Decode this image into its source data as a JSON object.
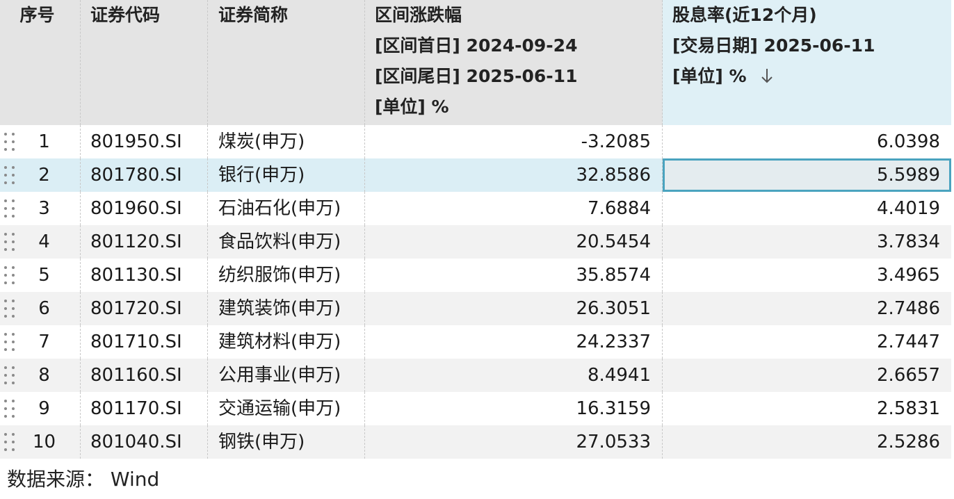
{
  "header": {
    "seq": "序号",
    "code": "证券代码",
    "name": "证券简称",
    "change": {
      "title": "区间涨跌幅",
      "start": "[区间首日] 2024-09-24",
      "end": "[区间尾日] 2025-06-11",
      "unit": "[单位] %"
    },
    "dividend": {
      "title": "股息率(近12个月)",
      "date": "[交易日期] 2025-06-11",
      "unit": "[单位] %",
      "sort_icon": "arrow-down"
    }
  },
  "rows": [
    {
      "seq": "1",
      "code": "801950.SI",
      "name": "煤炭(申万)",
      "change": "-3.2085",
      "dividend": "6.0398"
    },
    {
      "seq": "2",
      "code": "801780.SI",
      "name": "银行(申万)",
      "change": "32.8586",
      "dividend": "5.5989"
    },
    {
      "seq": "3",
      "code": "801960.SI",
      "name": "石油石化(申万)",
      "change": "7.6884",
      "dividend": "4.4019"
    },
    {
      "seq": "4",
      "code": "801120.SI",
      "name": "食品饮料(申万)",
      "change": "20.5454",
      "dividend": "3.7834"
    },
    {
      "seq": "5",
      "code": "801130.SI",
      "name": "纺织服饰(申万)",
      "change": "35.8574",
      "dividend": "3.4965"
    },
    {
      "seq": "6",
      "code": "801720.SI",
      "name": "建筑装饰(申万)",
      "change": "26.3051",
      "dividend": "2.7486"
    },
    {
      "seq": "7",
      "code": "801710.SI",
      "name": "建筑材料(申万)",
      "change": "24.2337",
      "dividend": "2.7447"
    },
    {
      "seq": "8",
      "code": "801160.SI",
      "name": "公用事业(申万)",
      "change": "8.4941",
      "dividend": "2.6657"
    },
    {
      "seq": "9",
      "code": "801170.SI",
      "name": "交通运输(申万)",
      "change": "16.3159",
      "dividend": "2.5831"
    },
    {
      "seq": "10",
      "code": "801040.SI",
      "name": "钢铁(申万)",
      "change": "27.0533",
      "dividend": "2.5286"
    }
  ],
  "footer": {
    "source": "数据来源： Wind"
  },
  "colors": {
    "selected_row": "#dbeef5",
    "selected_cell_border": "#4aa3bf",
    "header_bg": "#e4e4e4"
  }
}
